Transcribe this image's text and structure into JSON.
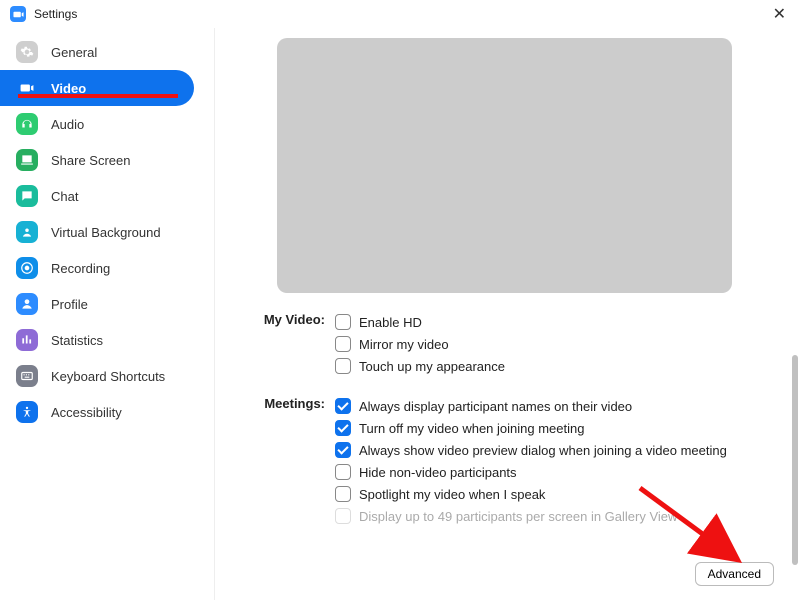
{
  "icons": {
    "general": "gear-icon",
    "video": "video-icon",
    "audio": "headphones-icon",
    "share": "share-screen-icon",
    "chat": "chat-icon",
    "vbg": "virtual-background-icon",
    "recording": "record-icon",
    "profile": "profile-icon",
    "statistics": "statistics-icon",
    "shortcuts": "keyboard-icon",
    "accessibility": "accessibility-icon"
  },
  "window": {
    "title": "Settings"
  },
  "sidebar": {
    "items": [
      {
        "label": "General",
        "active": false,
        "color": "#cfcfcf"
      },
      {
        "label": "Video",
        "active": true,
        "color": "#ffffff"
      },
      {
        "label": "Audio",
        "active": false,
        "color": "#2ecc71"
      },
      {
        "label": "Share Screen",
        "active": false,
        "color": "#27ae60"
      },
      {
        "label": "Chat",
        "active": false,
        "color": "#1abc9c"
      },
      {
        "label": "Virtual Background",
        "active": false,
        "color": "#17b1d4"
      },
      {
        "label": "Recording",
        "active": false,
        "color": "#0e8ee9"
      },
      {
        "label": "Profile",
        "active": false,
        "color": "#2d8cff"
      },
      {
        "label": "Statistics",
        "active": false,
        "color": "#8e6bd6"
      },
      {
        "label": "Keyboard Shortcuts",
        "active": false,
        "color": "#7b7f8c"
      },
      {
        "label": "Accessibility",
        "active": false,
        "color": "#0e72ed"
      }
    ]
  },
  "sections": {
    "myvideo": {
      "title": "My Video:",
      "options": [
        {
          "label": "Enable HD",
          "checked": false
        },
        {
          "label": "Mirror my video",
          "checked": false
        },
        {
          "label": "Touch up my appearance",
          "checked": false
        }
      ]
    },
    "meetings": {
      "title": "Meetings:",
      "options": [
        {
          "label": "Always display participant names on their video",
          "checked": true
        },
        {
          "label": "Turn off my video when joining meeting",
          "checked": true
        },
        {
          "label": "Always show video preview dialog when joining a video meeting",
          "checked": true
        },
        {
          "label": "Hide non-video participants",
          "checked": false
        },
        {
          "label": "Spotlight my video when I speak",
          "checked": false
        },
        {
          "label": "Display up to 49 participants per screen in Gallery View",
          "checked": false,
          "disabled": true
        }
      ]
    }
  },
  "advanced_button": "Advanced"
}
